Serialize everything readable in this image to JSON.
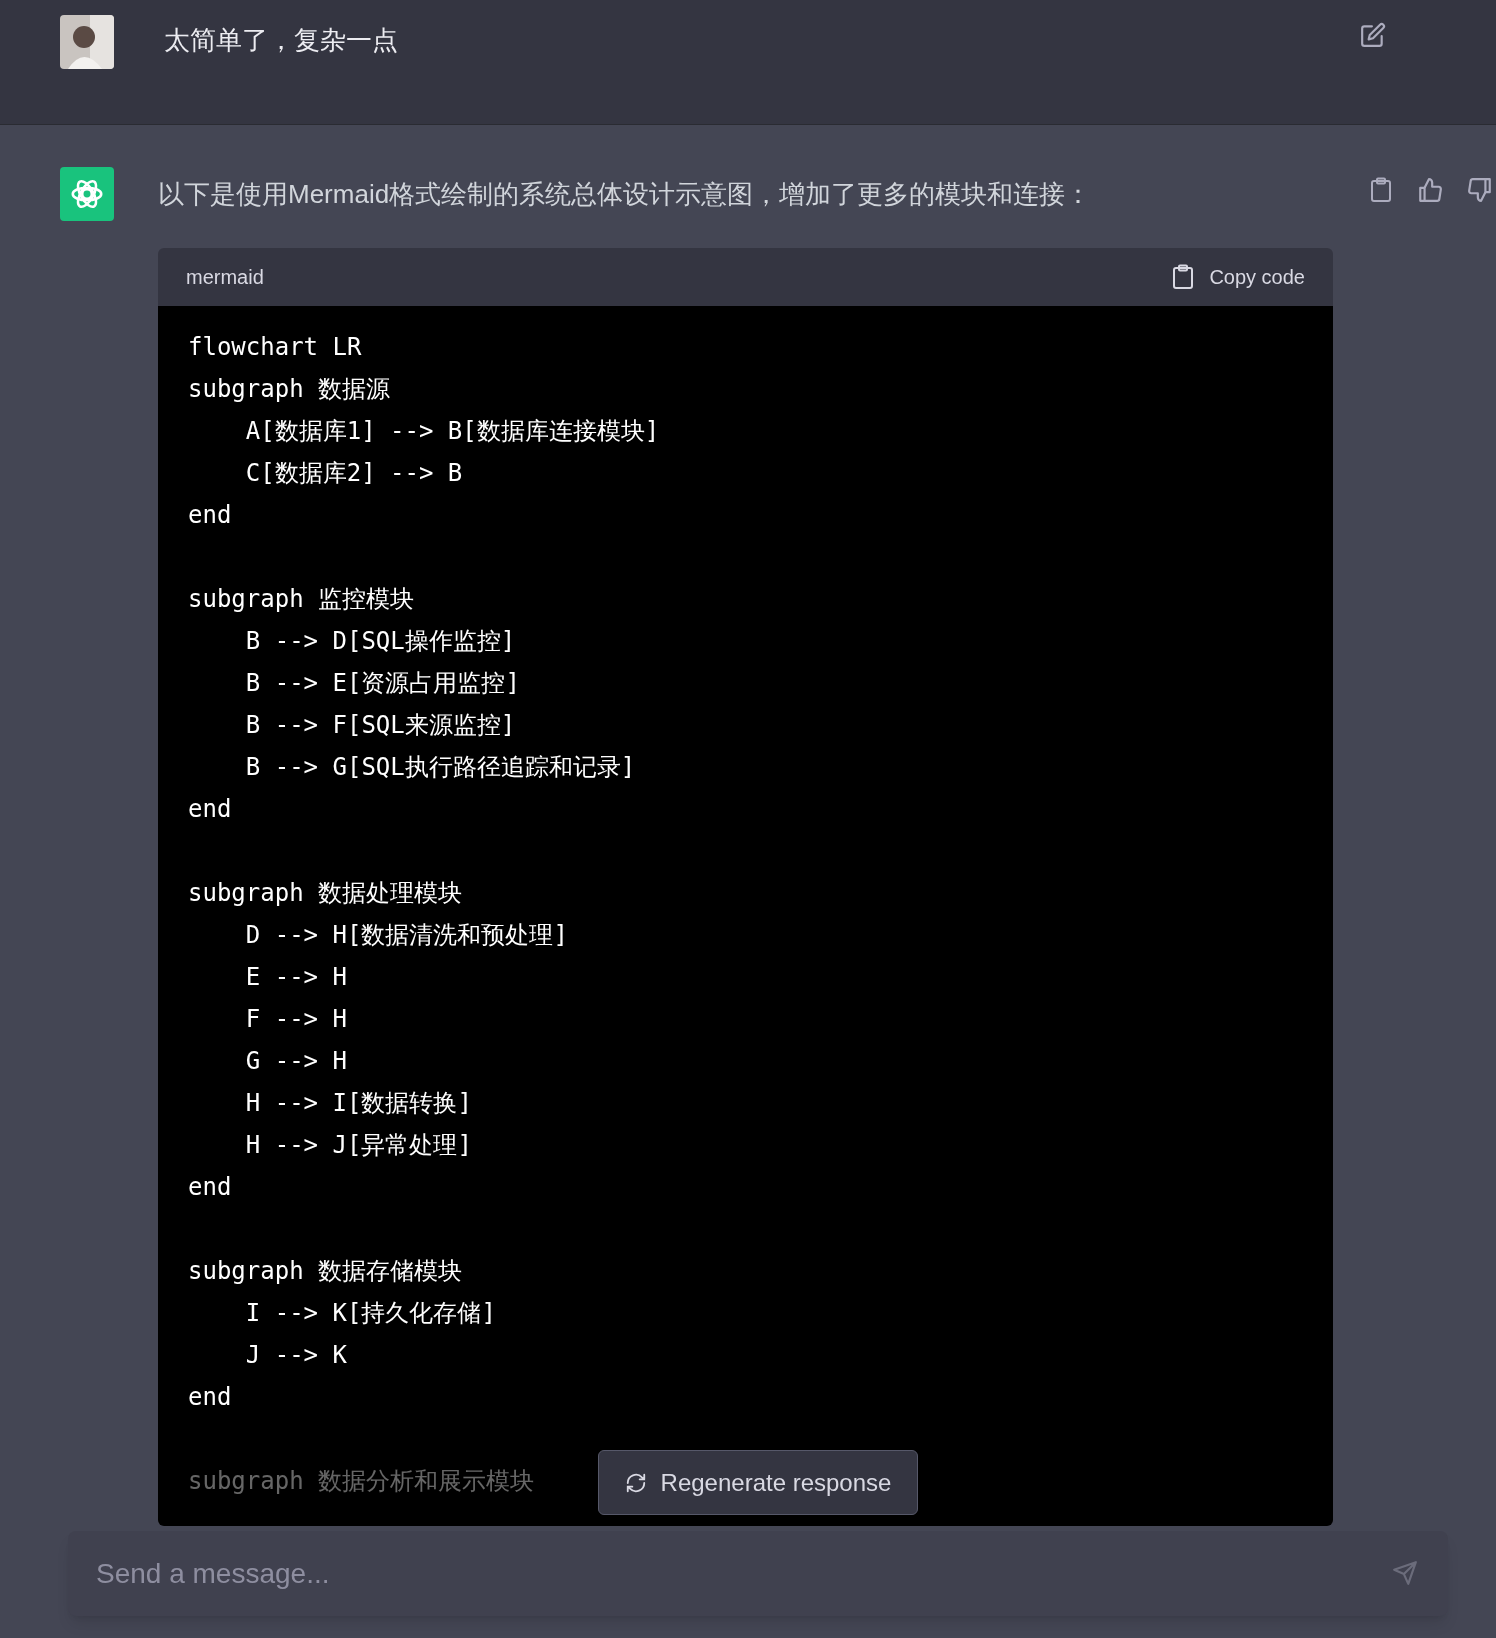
{
  "user_message": {
    "text": "太简单了，复杂一点"
  },
  "assistant_message": {
    "text": "以下是使用Mermaid格式绘制的系统总体设计示意图，增加了更多的模块和连接："
  },
  "code_block": {
    "language": "mermaid",
    "copy_label": "Copy code",
    "blocks": [
      [
        "flowchart LR",
        "subgraph 数据源",
        "    A[数据库1] --> B[数据库连接模块]",
        "    C[数据库2] --> B",
        "end"
      ],
      [
        "subgraph 监控模块",
        "    B --> D[SQL操作监控]",
        "    B --> E[资源占用监控]",
        "    B --> F[SQL来源监控]",
        "    B --> G[SQL执行路径追踪和记录]",
        "end"
      ],
      [
        "subgraph 数据处理模块",
        "    D --> H[数据清洗和预处理]",
        "    E --> H",
        "    F --> H",
        "    G --> H",
        "    H --> I[数据转换]",
        "    H --> J[异常处理]",
        "end"
      ],
      [
        "subgraph 数据存储模块",
        "    I --> K[持久化存储]",
        "    J --> K",
        "end"
      ],
      [
        "subgraph 数据分析和展示模块"
      ]
    ],
    "faded_last_block": true
  },
  "regenerate_button": {
    "label": "Regenerate response"
  },
  "message_input": {
    "placeholder": "Send a message..."
  }
}
